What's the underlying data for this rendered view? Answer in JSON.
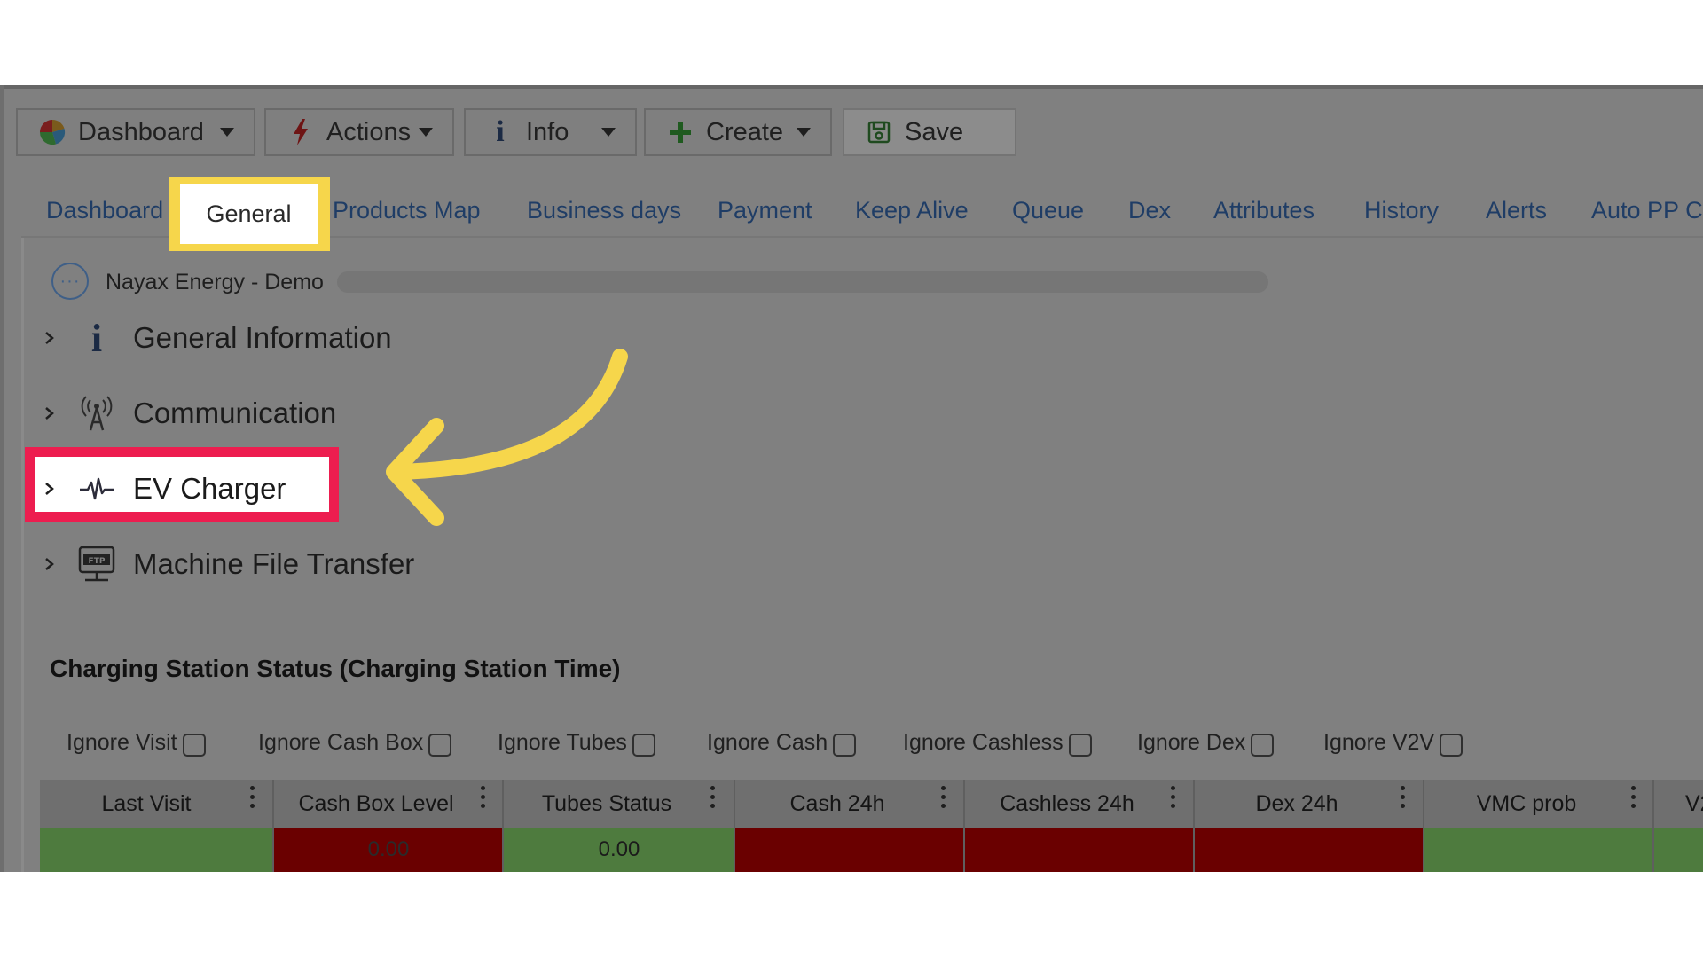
{
  "toolbar": {
    "dashboard": "Dashboard",
    "actions": "Actions",
    "info": "Info",
    "create": "Create",
    "save": "Save"
  },
  "tabs": [
    "Dashboard",
    "General",
    "Products Map",
    "Business days",
    "Payment",
    "Keep Alive",
    "Queue",
    "Dex",
    "Attributes",
    "History",
    "Alerts",
    "Auto PP C"
  ],
  "machine": {
    "name": "Nayax Energy - Demo"
  },
  "sections": [
    "General Information",
    "Communication",
    "EV Charger",
    "Machine File Transfer"
  ],
  "status": {
    "heading": "Charging Station Status (Charging Station Time)",
    "ignore": [
      "Ignore Visit",
      "Ignore Cash Box",
      "Ignore Tubes",
      "Ignore Cash",
      "Ignore Cashless",
      "Ignore Dex",
      "Ignore V2V"
    ],
    "columns": [
      "Last Visit",
      "Cash Box Level",
      "Tubes Status",
      "Cash 24h",
      "Cashless 24h",
      "Dex 24h",
      "VMC prob",
      "V2"
    ],
    "row": [
      "",
      "0.00",
      "0.00",
      "",
      "",
      "",
      "",
      ""
    ],
    "row_status": [
      "green",
      "red",
      "green",
      "red",
      "red",
      "red",
      "green",
      "green"
    ]
  },
  "colors": {
    "highlight_tab": "#f6d64b",
    "highlight_section": "#ed1d4f",
    "arrow": "#f6d64b",
    "status_red": "#6a0000",
    "status_green": "#4e7b3e"
  }
}
